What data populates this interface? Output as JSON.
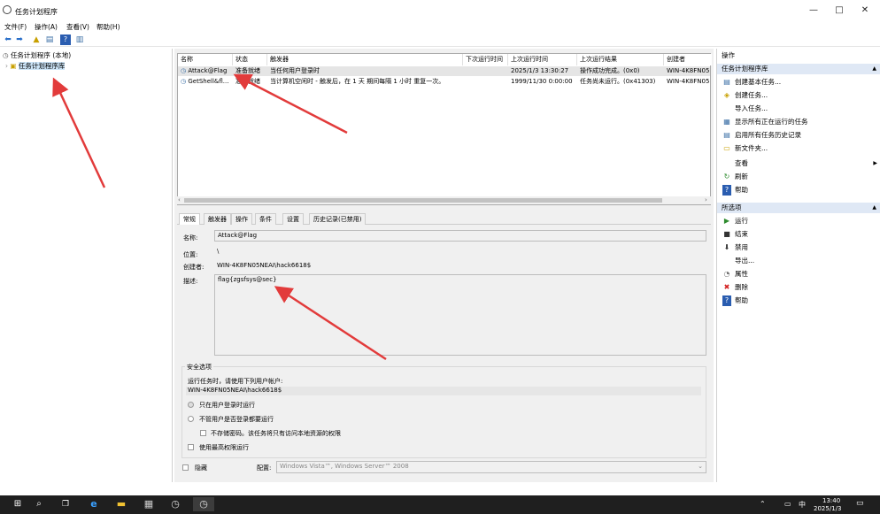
{
  "window": {
    "title": "任务计划程序",
    "minimize": "—",
    "maximize": "□",
    "close": "✕"
  },
  "menu": [
    "文件(F)",
    "操作(A)",
    "查看(V)",
    "帮助(H)"
  ],
  "tree": {
    "root": "任务计划程序 (本地)",
    "library": "任务计划程序库"
  },
  "list": {
    "columns": [
      "名称",
      "状态",
      "触发器",
      "下次运行时间",
      "上次运行时间",
      "上次运行结果",
      "创建者"
    ],
    "rows": [
      {
        "name": "Attack@Flag",
        "status": "准备就绪",
        "trigger": "当任何用户登录时",
        "next": "",
        "last": "2025/1/3 13:30:27",
        "result": "操作成功完成。(0x0)",
        "author": "WIN-4K8FN05"
      },
      {
        "name": "GetShell&fl...",
        "status": "准备就绪",
        "trigger": "当计算机空闲时 - 触发后，在 1 天 期间每隔 1 小时 重复一次。",
        "next": "",
        "last": "1999/11/30 0:00:00",
        "result": "任务尚未运行。(0x41303)",
        "author": "WIN-4K8FN05"
      }
    ]
  },
  "tabs": [
    "常规",
    "触发器",
    "操作",
    "条件",
    "设置",
    "历史记录(已禁用)"
  ],
  "general": {
    "name_label": "名称:",
    "name_value": "Attack@Flag",
    "location_label": "位置:",
    "location_value": "\\",
    "author_label": "创建者:",
    "author_value": "WIN-4K8FN05NEAI\\hack6618$",
    "desc_label": "描述:",
    "desc_value": "flag{zgsfsys@sec}"
  },
  "security": {
    "title": "安全选项",
    "run_as_label": "运行任务时，请使用下列用户帐户:",
    "run_as_value": "WIN-4K8FN05NEAI\\hack6618$",
    "opt_logged_on": "只在用户登录时运行",
    "opt_regardless": "不管用户是否登录都要运行",
    "opt_no_password": "不存储密码。该任务将只有访问本地资源的权限",
    "opt_highest": "使用最高权限运行"
  },
  "bottom": {
    "hidden_label": "隐藏",
    "config_label": "配置:",
    "config_value": "Windows Vista™, Windows Server™ 2008"
  },
  "actions": {
    "header": "操作",
    "section1": "任务计划程序库",
    "items1": [
      {
        "icon": "▤",
        "label": "创建基本任务..."
      },
      {
        "icon": "◈",
        "label": "创建任务..."
      },
      {
        "icon": "",
        "label": "导入任务..."
      },
      {
        "icon": "▦",
        "label": "显示所有正在运行的任务"
      },
      {
        "icon": "▤",
        "label": "启用所有任务历史记录"
      },
      {
        "icon": "▭",
        "label": "新文件夹..."
      },
      {
        "icon": "",
        "label": "查看"
      },
      {
        "icon": "↻",
        "label": "刷新"
      },
      {
        "icon": "?",
        "label": "帮助"
      }
    ],
    "section2": "所选项",
    "items2": [
      {
        "icon": "▶",
        "label": "运行"
      },
      {
        "icon": "■",
        "label": "结束"
      },
      {
        "icon": "⬇",
        "label": "禁用"
      },
      {
        "icon": "",
        "label": "导出..."
      },
      {
        "icon": "◔",
        "label": "属性"
      },
      {
        "icon": "✖",
        "label": "删除"
      },
      {
        "icon": "?",
        "label": "帮助"
      }
    ]
  },
  "taskbar": {
    "ime": "中",
    "time": "13:40",
    "date": "2025/1/3"
  }
}
